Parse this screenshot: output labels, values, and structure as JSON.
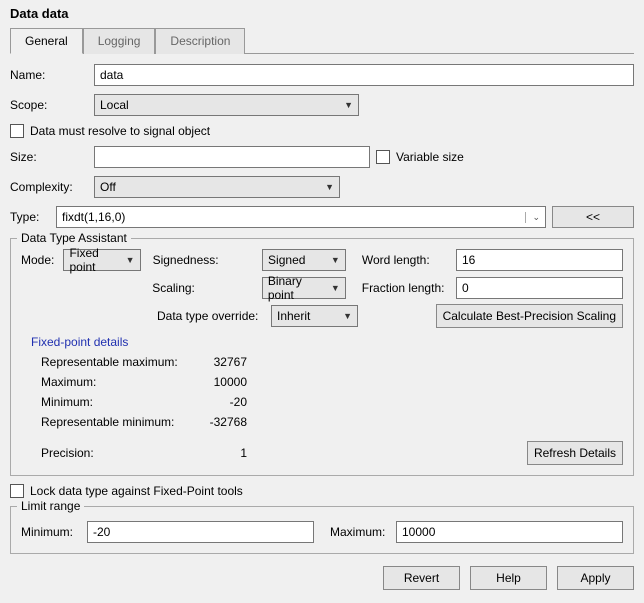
{
  "window_title": "Data data",
  "tabs": [
    "General",
    "Logging",
    "Description"
  ],
  "fields": {
    "name_label": "Name:",
    "name_value": "data",
    "scope_label": "Scope:",
    "scope_value": "Local",
    "data_resolve_label": "Data must resolve to signal object",
    "size_label": "Size:",
    "size_value": "",
    "variable_size_label": "Variable size",
    "complexity_label": "Complexity:",
    "complexity_value": "Off",
    "type_label": "Type:",
    "type_value": "fixdt(1,16,0)",
    "collapse_btn": "<<"
  },
  "dta": {
    "legend": "Data Type Assistant",
    "mode_label": "Mode:",
    "mode_value": "Fixed point",
    "signedness_label": "Signedness:",
    "signedness_value": "Signed",
    "word_length_label": "Word length:",
    "word_length_value": "16",
    "scaling_label": "Scaling:",
    "scaling_value": "Binary point",
    "fraction_length_label": "Fraction length:",
    "fraction_length_value": "0",
    "override_label": "Data type override:",
    "override_value": "Inherit",
    "calc_btn": "Calculate Best-Precision Scaling",
    "fp_title": "Fixed-point details",
    "rep_max_label": "Representable maximum:",
    "rep_max_value": "32767",
    "max_label": "Maximum:",
    "max_value": "10000",
    "min_label": "Minimum:",
    "min_value": "-20",
    "rep_min_label": "Representable minimum:",
    "rep_min_value": "-32768",
    "precision_label": "Precision:",
    "precision_value": "1",
    "refresh_btn": "Refresh Details"
  },
  "lock_label": "Lock data type against Fixed-Point tools",
  "limit": {
    "legend": "Limit range",
    "min_label": "Minimum:",
    "min_value": "-20",
    "max_label": "Maximum:",
    "max_value": "10000"
  },
  "buttons": {
    "revert": "Revert",
    "help": "Help",
    "apply": "Apply"
  }
}
